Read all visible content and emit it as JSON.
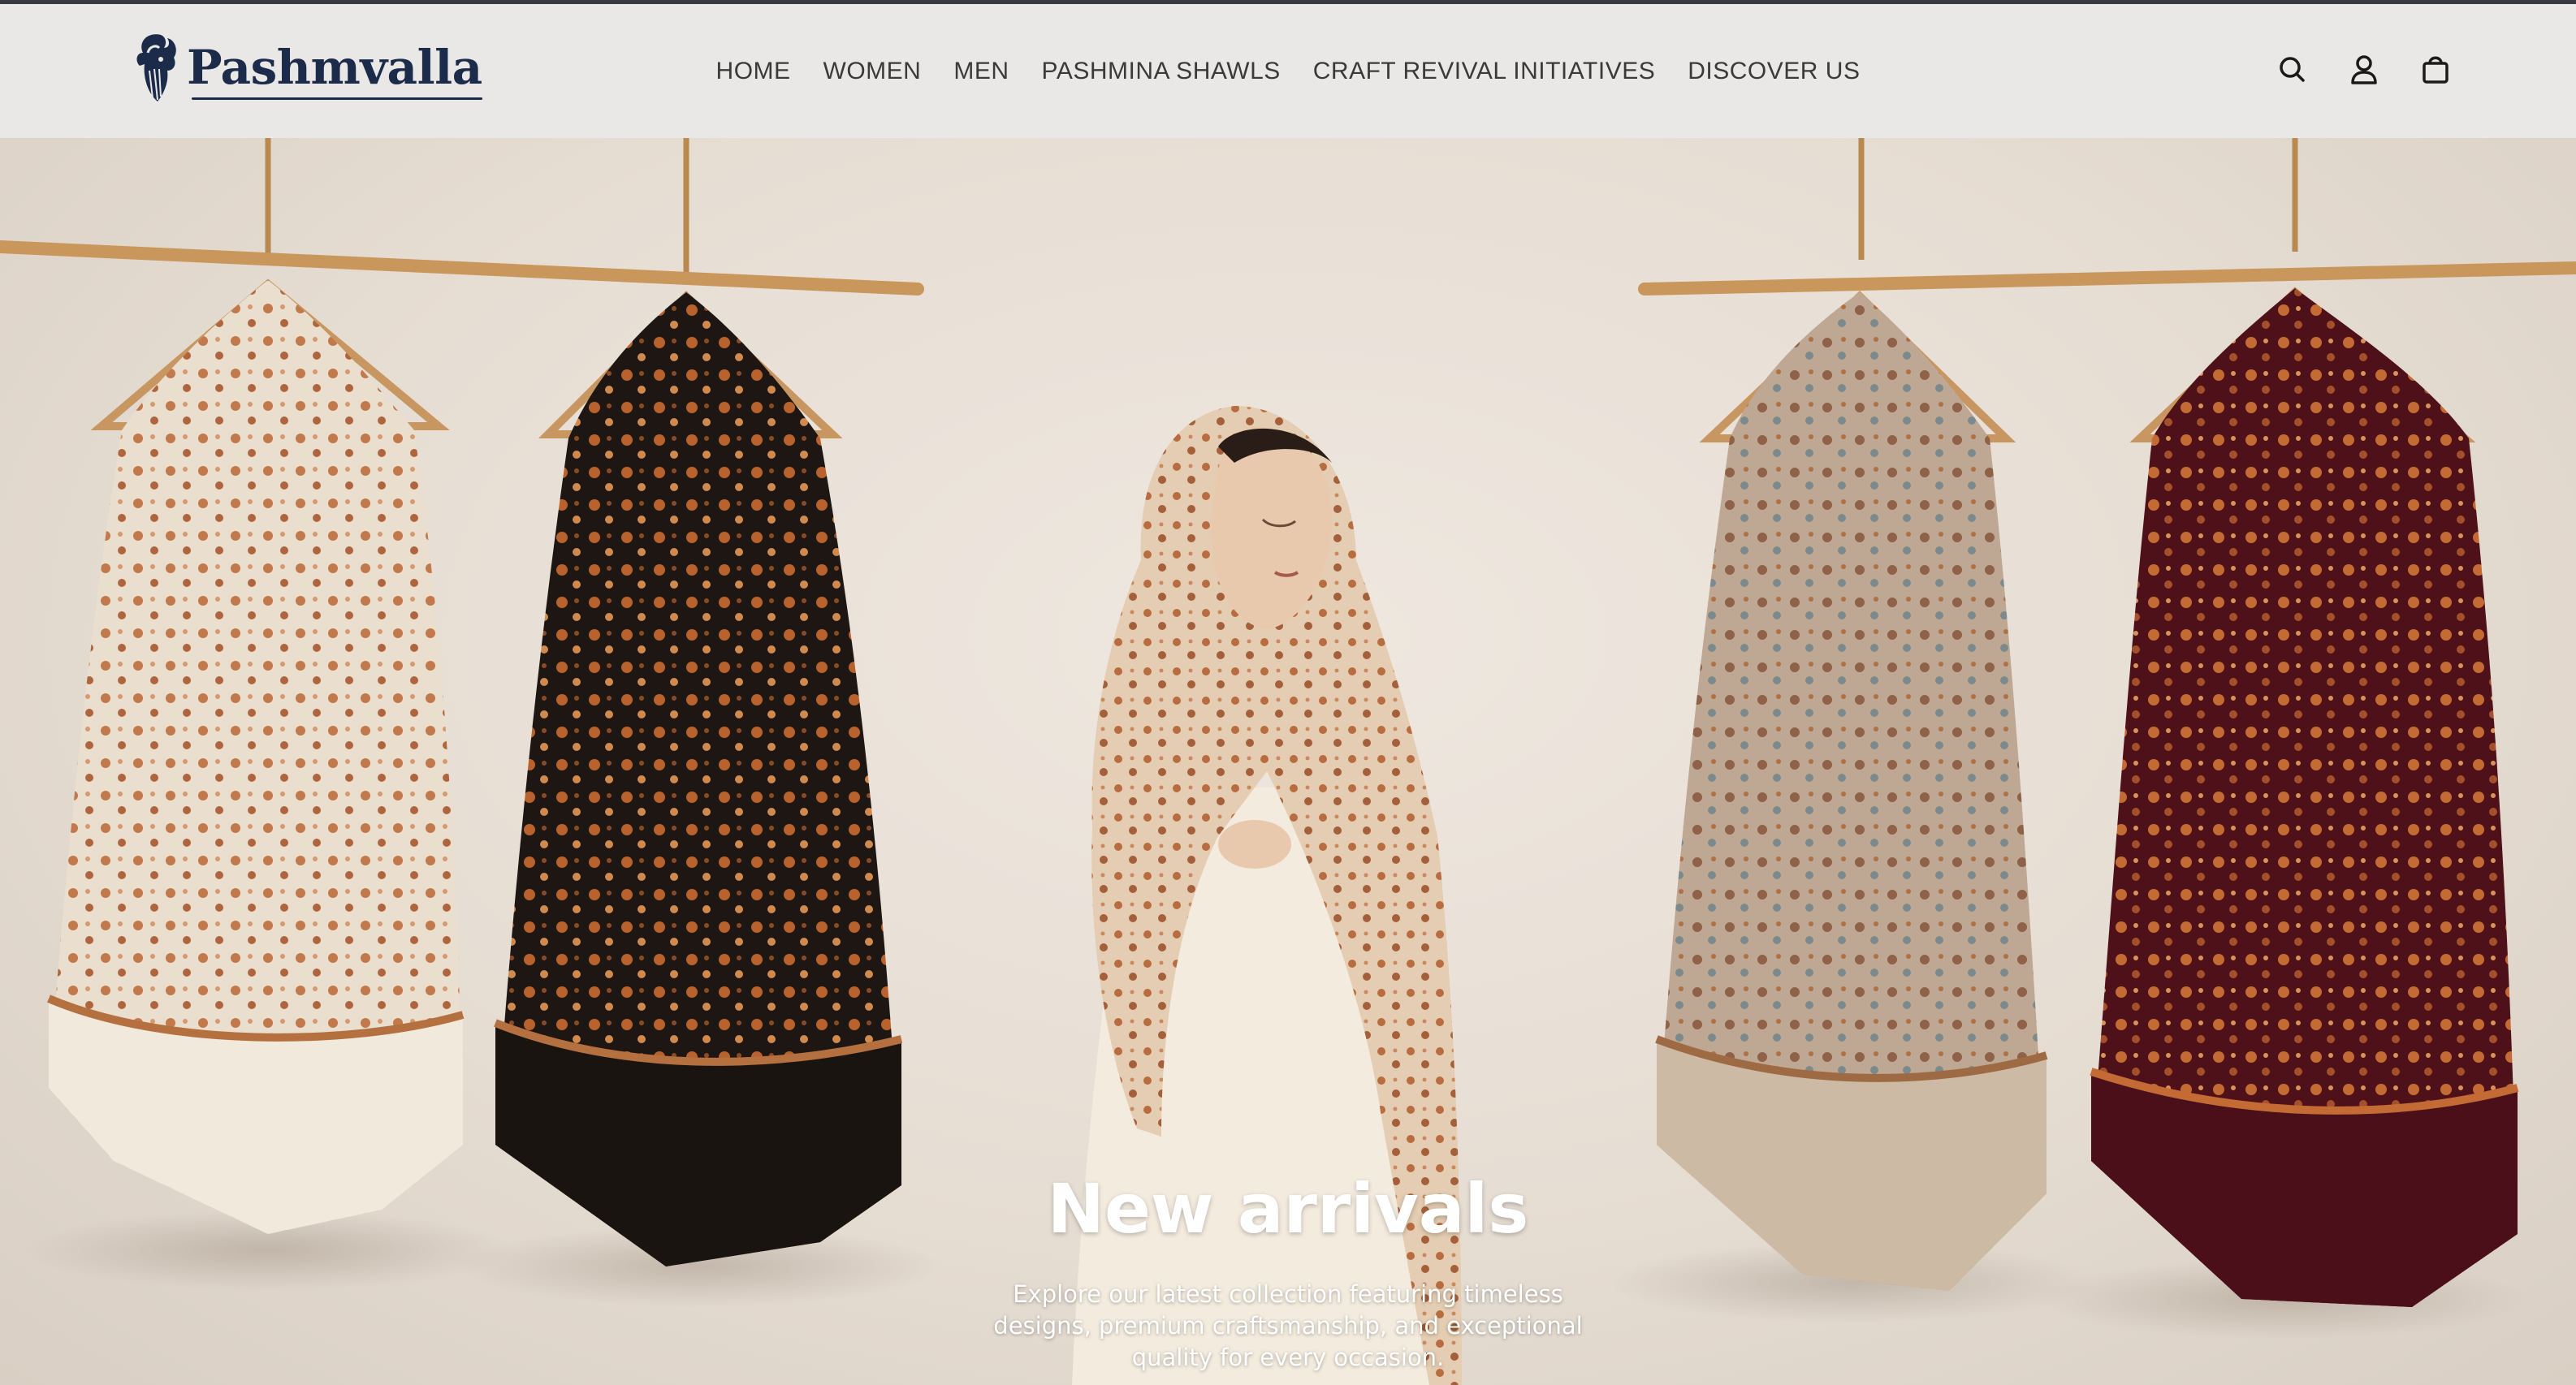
{
  "brand": {
    "name": "Pashmvalla",
    "logo_icon": "goat-head-icon",
    "colors": {
      "brand_navy": "#1c2b4a",
      "topline": "#3a3b40",
      "header_bg": "#e9e8e6"
    }
  },
  "nav": {
    "items": [
      {
        "label": "HOME"
      },
      {
        "label": "WOMEN"
      },
      {
        "label": "MEN"
      },
      {
        "label": "PASHMINA SHAWLS"
      },
      {
        "label": "CRAFT REVIVAL INITIATIVES"
      },
      {
        "label": "DISCOVER US"
      }
    ]
  },
  "header_icons": [
    "search-icon",
    "account-icon",
    "cart-bag-icon"
  ],
  "hero": {
    "title": "New arrivals",
    "subtitle": "Explore our latest collection featuring timeless designs, premium craftsmanship, and exceptional quality for every occasion.",
    "image_description_colors": {
      "shawl_ivory": "#efe6d8",
      "shawl_black": "#1c1714",
      "shawl_beige": "#c7b5a2",
      "shawl_maroon": "#5a1420",
      "embroidery": "#b8653a"
    }
  }
}
